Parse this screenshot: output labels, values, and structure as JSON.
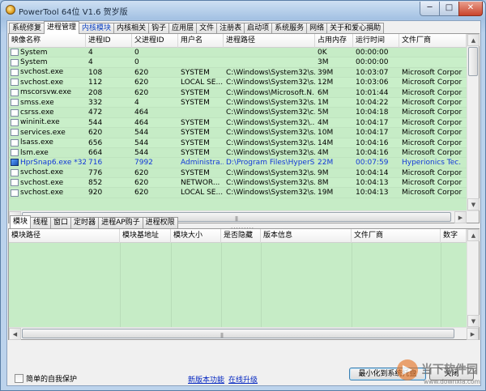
{
  "window": {
    "title": "PowerTool 64位 V1.6 贺岁版",
    "min": "─",
    "max": "□",
    "close": "✕"
  },
  "main_tabs": [
    {
      "label": "系统修复"
    },
    {
      "label": "进程管理"
    },
    {
      "label": "内核模块"
    },
    {
      "label": "内核相关"
    },
    {
      "label": "钩子"
    },
    {
      "label": "应用层"
    },
    {
      "label": "文件"
    },
    {
      "label": "注册表"
    },
    {
      "label": "启动项"
    },
    {
      "label": "系统服务"
    },
    {
      "label": "网络"
    },
    {
      "label": "关于和爱心捐助"
    }
  ],
  "process_table": {
    "columns": [
      "映像名称",
      "进程ID",
      "父进程ID",
      "用户名",
      "进程路径",
      "占用内存",
      "运行时间",
      "文件厂商"
    ],
    "rows": [
      [
        "System",
        "4",
        "0",
        "",
        "",
        "0K",
        "00:00:00",
        ""
      ],
      [
        "System",
        "4",
        "0",
        "",
        "",
        "3M",
        "00:00:00",
        ""
      ],
      [
        "svchost.exe",
        "108",
        "620",
        "SYSTEM",
        "C:\\Windows\\System32\\s...",
        "39M",
        "10:03:07",
        "Microsoft Corpor"
      ],
      [
        "svchost.exe",
        "112",
        "620",
        "LOCAL SE...",
        "C:\\Windows\\System32\\s...",
        "12M",
        "10:03:06",
        "Microsoft Corpor"
      ],
      [
        "mscorsvw.exe",
        "208",
        "620",
        "SYSTEM",
        "C:\\Windows\\Microsoft.N...",
        "6M",
        "10:01:44",
        "Microsoft Corpor"
      ],
      [
        "smss.exe",
        "332",
        "4",
        "SYSTEM",
        "C:\\Windows\\System32\\s...",
        "1M",
        "10:04:22",
        "Microsoft Corpor"
      ],
      [
        "csrss.exe",
        "472",
        "464",
        "",
        "C:\\Windows\\System32\\c...",
        "5M",
        "10:04:18",
        "Microsoft Corpor"
      ],
      [
        "wininit.exe",
        "544",
        "464",
        "SYSTEM",
        "C:\\Windows\\System32\\...",
        "4M",
        "10:04:17",
        "Microsoft Corpor"
      ],
      [
        "services.exe",
        "620",
        "544",
        "SYSTEM",
        "C:\\Windows\\System32\\s...",
        "10M",
        "10:04:17",
        "Microsoft Corpor"
      ],
      [
        "lsass.exe",
        "656",
        "544",
        "SYSTEM",
        "C:\\Windows\\System32\\s...",
        "14M",
        "10:04:16",
        "Microsoft Corpor"
      ],
      [
        "lsm.exe",
        "664",
        "544",
        "SYSTEM",
        "C:\\Windows\\System32\\s...",
        "4M",
        "10:04:16",
        "Microsoft Corpor"
      ],
      [
        "HprSnap6.exe *32",
        "716",
        "7992",
        "Administra...",
        "D:\\Program Files\\HyperS...",
        "22M",
        "00:07:59",
        "Hyperionics Tec."
      ],
      [
        "svchost.exe",
        "776",
        "620",
        "SYSTEM",
        "C:\\Windows\\System32\\s...",
        "9M",
        "10:04:14",
        "Microsoft Corpor"
      ],
      [
        "svchost.exe",
        "852",
        "620",
        "NETWOR...",
        "C:\\Windows\\System32\\s...",
        "8M",
        "10:04:13",
        "Microsoft Corpor"
      ],
      [
        "svchost.exe",
        "920",
        "620",
        "LOCAL SE...",
        "C:\\Windows\\System32\\s...",
        "19M",
        "10:04:13",
        "Microsoft Corpor"
      ]
    ]
  },
  "sub_tabs": [
    {
      "label": "模块"
    },
    {
      "label": "线程"
    },
    {
      "label": "窗口"
    },
    {
      "label": "定时器"
    },
    {
      "label": "进程AP购子"
    },
    {
      "label": "进程权限"
    }
  ],
  "module_table": {
    "columns": [
      "模块路径",
      "模块基地址",
      "模块大小",
      "是否隐藏",
      "版本信息",
      "文件厂商",
      "数字"
    ]
  },
  "footer": {
    "checkbox_label": "简单的自我保护",
    "link_new_features": "新版本功能",
    "link_update": "在线升级",
    "btn_minimize": "最小化到系统托盘",
    "btn_close": "关闭"
  },
  "watermark": {
    "text": "当下软件园",
    "subtext": "www.downxia.com"
  },
  "colors": {
    "row_bg": "#c6ecc6",
    "highlight_text": "#1238d8",
    "link": "#0024c0"
  }
}
